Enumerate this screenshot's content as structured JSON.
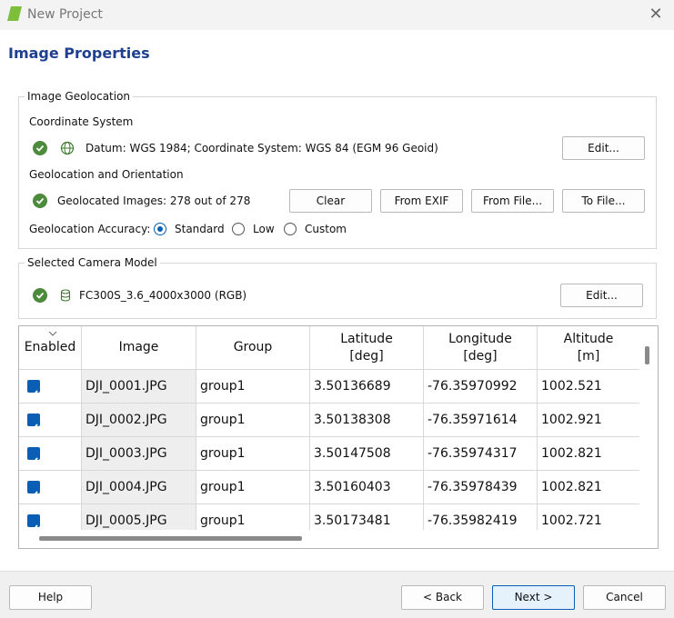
{
  "window": {
    "title": "New Project",
    "close_glyph": "✕"
  },
  "page": {
    "title": "Image Properties"
  },
  "geolocation": {
    "group_label": "Image Geolocation",
    "coord_label": "Coordinate System",
    "coord_text": "Datum: WGS 1984; Coordinate System: WGS 84 (EGM 96 Geoid)",
    "coord_edit": "Edit...",
    "orient_label": "Geolocation and Orientation",
    "geolocated_text": "Geolocated Images: 278 out of 278",
    "buttons": {
      "clear": "Clear",
      "from_exif": "From EXIF",
      "from_file": "From File...",
      "to_file": "To File..."
    },
    "accuracy_label": "Geolocation Accuracy:",
    "accuracy_options": [
      "Standard",
      "Low",
      "Custom"
    ],
    "accuracy_selected": "Standard"
  },
  "camera": {
    "group_label": "Selected Camera Model",
    "model": "FC300S_3.6_4000x3000 (RGB)",
    "edit": "Edit..."
  },
  "table": {
    "columns": [
      "Enabled",
      "Image",
      "Group",
      "Latitude\n[deg]",
      "Longitude\n[deg]",
      "Altitude\n[m]"
    ],
    "rows": [
      {
        "enabled": true,
        "image": "DJI_0001.JPG",
        "group": "group1",
        "lat": "3.50136689",
        "lon": "-76.35970992",
        "alt": "1002.521"
      },
      {
        "enabled": true,
        "image": "DJI_0002.JPG",
        "group": "group1",
        "lat": "3.50138308",
        "lon": "-76.35971614",
        "alt": "1002.921"
      },
      {
        "enabled": true,
        "image": "DJI_0003.JPG",
        "group": "group1",
        "lat": "3.50147508",
        "lon": "-76.35974317",
        "alt": "1002.821"
      },
      {
        "enabled": true,
        "image": "DJI_0004.JPG",
        "group": "group1",
        "lat": "3.50160403",
        "lon": "-76.35978439",
        "alt": "1002.821"
      },
      {
        "enabled": true,
        "image": "DJI_0005.JPG",
        "group": "group1",
        "lat": "3.50173481",
        "lon": "-76.35982419",
        "alt": "1002.721"
      }
    ]
  },
  "footer": {
    "help": "Help",
    "back": "< Back",
    "next": "Next >",
    "cancel": "Cancel"
  },
  "colors": {
    "accent": "#0a5fb4",
    "title": "#1f3f8f",
    "ok": "#4b8b3b"
  }
}
